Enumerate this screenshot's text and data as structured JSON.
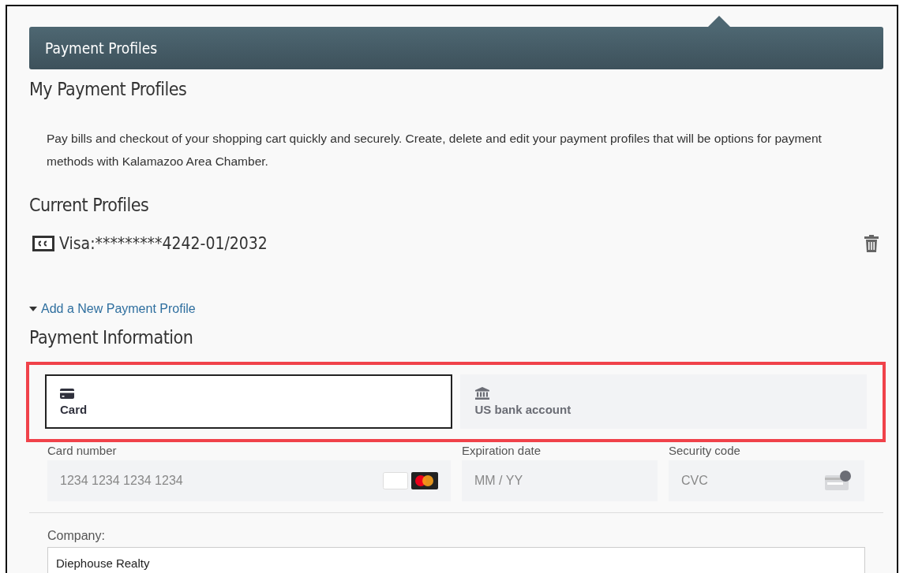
{
  "panel": {
    "title": "Payment Profiles"
  },
  "heading": "My Payment Profiles",
  "intro": "Pay bills and checkout of your shopping cart quickly and securely. Create, delete and edit your payment profiles that will be options for payment methods with Kalamazoo Area Chamber.",
  "current_profiles": {
    "heading": "Current Profiles",
    "profiles": [
      {
        "label": "Visa:*********4242-01/2032"
      }
    ]
  },
  "add_link": "Add a New Payment Profile",
  "payment_information": {
    "heading": "Payment Information",
    "methods": [
      {
        "kind": "card",
        "label": "Card",
        "selected": true
      },
      {
        "kind": "bank",
        "label": "US bank account",
        "selected": false
      }
    ],
    "fields": [
      {
        "kind": "card_number",
        "label": "Card number",
        "placeholder": "1234 1234 1234 1234"
      },
      {
        "kind": "expiry",
        "label": "Expiration date",
        "placeholder": "MM / YY"
      },
      {
        "kind": "cvc",
        "label": "Security code",
        "placeholder": "CVC"
      }
    ]
  },
  "company": {
    "label": "Company:",
    "value": "Diephouse Realty"
  }
}
